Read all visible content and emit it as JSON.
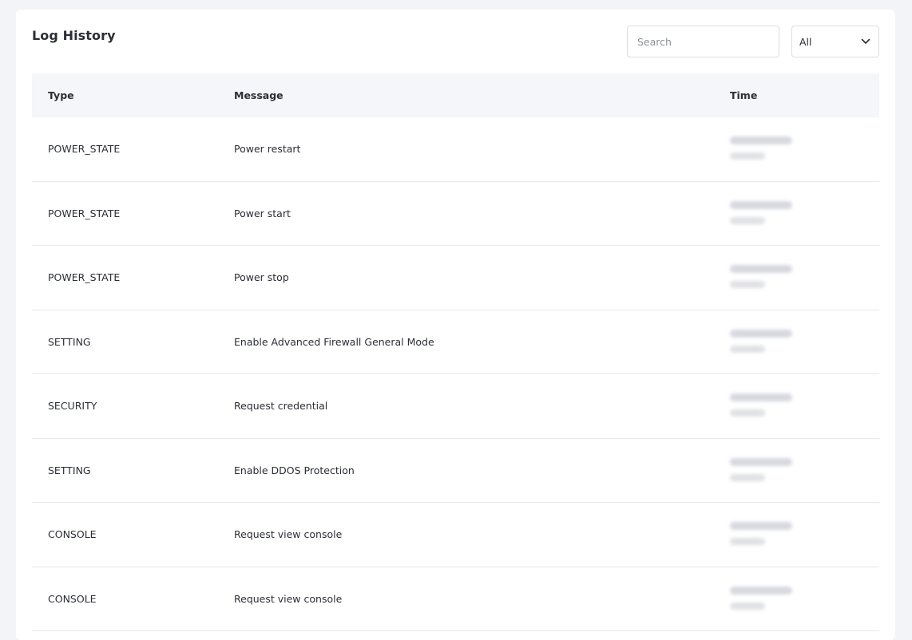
{
  "log_history": {
    "title": "Log History",
    "search": {
      "placeholder": "Search",
      "value": ""
    },
    "filter": {
      "selected": "All"
    },
    "table": {
      "columns": {
        "type": "Type",
        "message": "Message",
        "time": "Time"
      },
      "rows": [
        {
          "type": "POWER_STATE",
          "message": "Power restart"
        },
        {
          "type": "POWER_STATE",
          "message": "Power start"
        },
        {
          "type": "POWER_STATE",
          "message": "Power stop"
        },
        {
          "type": "SETTING",
          "message": "Enable Advanced Firewall General Mode"
        },
        {
          "type": "SECURITY",
          "message": "Request credential"
        },
        {
          "type": "SETTING",
          "message": "Enable DDOS Protection"
        },
        {
          "type": "CONSOLE",
          "message": "Request view console"
        },
        {
          "type": "CONSOLE",
          "message": "Request view console"
        }
      ]
    }
  },
  "colors": {
    "page_background": "#f3f4f7",
    "card_background": "#ffffff",
    "header_row_background": "#f5f6f9",
    "text": "#2b2e35",
    "row_border": "#e6e8ec"
  },
  "icons": {
    "filter_chevron": "chevron-down-icon"
  }
}
